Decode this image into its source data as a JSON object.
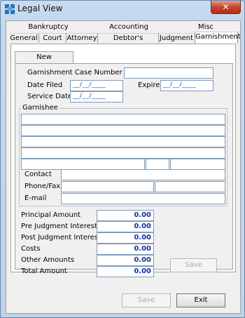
{
  "window": {
    "title": "Legal View",
    "close_symbol": "✕"
  },
  "tabs_row1": [
    "Bankruptcy",
    "Accounting",
    "Misc"
  ],
  "tabs_row2": [
    "General",
    "Court",
    "Attorney",
    "Debtor's Attorney",
    "Judgment",
    "Garnishment"
  ],
  "selected_tab": "Garnishment",
  "subtab": "New Garnishment",
  "form": {
    "case_number_label": "Garnishment Case Number",
    "date_filed_label": "Date Filed",
    "expires_label": "Expires",
    "service_date_label": "Service Date",
    "date_mask": "__/__/____",
    "garnishee_label": "Garnishee",
    "contact_label": "Contact",
    "phone_fax_label": "Phone/Fax",
    "email_label": "E-mail"
  },
  "amounts": {
    "principal_label": "Principal Amount",
    "principal_value": "0.00",
    "pre_judgment_label": "Pre Judgment Interest",
    "pre_judgment_value": "0.00",
    "post_judgment_label": "Post Judgment Interest",
    "post_judgment_value": "0.00",
    "costs_label": "Costs",
    "costs_value": "0.00",
    "other_label": "Other Amounts",
    "other_value": "0.00",
    "total_label": "Total Amount",
    "total_value": "0.00"
  },
  "buttons": {
    "inner_save": "Save",
    "save": "Save",
    "exit": "Exit"
  },
  "colors": {
    "accent_blue": "#1530a8",
    "date_mask": "#2040c0",
    "close_red": "#c7442b"
  }
}
